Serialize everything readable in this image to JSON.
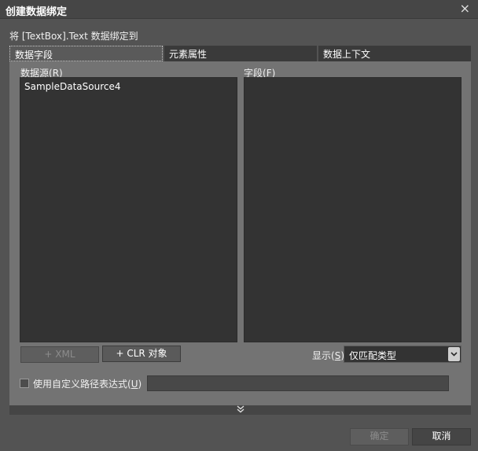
{
  "window": {
    "title": "创建数据绑定",
    "close_glyph": "×"
  },
  "subtitle": "将 [TextBox].Text 数据绑定到",
  "tabs": [
    {
      "label": "数据字段"
    },
    {
      "label": "元素属性"
    },
    {
      "label": "数据上下文"
    }
  ],
  "data_source": {
    "label": "数据源",
    "access_key": "R",
    "items": [
      "SampleDataSource4"
    ]
  },
  "fields": {
    "label": "字段",
    "access_key": "F",
    "items": []
  },
  "buttons": {
    "add_xml": "+ XML",
    "add_clr": "+ CLR 对象",
    "ok": "确定",
    "cancel": "取消"
  },
  "display": {
    "label": "显示",
    "access_key": "S",
    "selected": "仅匹配类型"
  },
  "custom_path": {
    "label": "使用自定义路径表达式",
    "access_key": "U",
    "checked": false,
    "value": ""
  },
  "icons": {
    "close": "close-icon",
    "expander": "chevron-double-down-icon",
    "combo": "chevron-down-icon"
  },
  "colors": {
    "background": "#535353",
    "panel": "#737373",
    "list": "#333333",
    "titlebar": "#464646"
  }
}
